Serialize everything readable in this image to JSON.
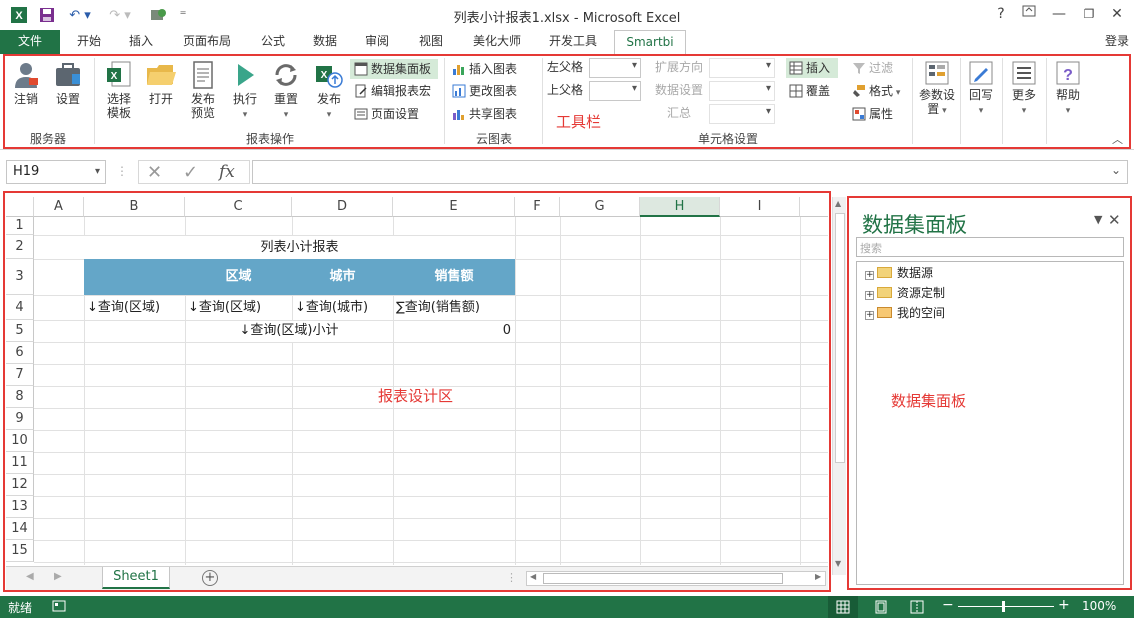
{
  "window": {
    "title": "列表小计报表1.xlsx - Microsoft Excel",
    "help": "?",
    "minimize": "—",
    "restore": "❐",
    "close": "✕",
    "signin": "登录"
  },
  "tabs": [
    "文件",
    "开始",
    "插入",
    "页面布局",
    "公式",
    "数据",
    "审阅",
    "视图",
    "美化大师",
    "开发工具",
    "Smartbi"
  ],
  "ribbon": {
    "server": {
      "logout": "注销",
      "settings": "设置",
      "group": "服务器"
    },
    "report": {
      "select_template": "选择\n模板",
      "open": "打开",
      "publish_preview": "发布\n预览",
      "execute": "执行",
      "reset": "重置",
      "publish": "发布",
      "dataset_panel": "数据集面板",
      "edit_macro": "编辑报表宏",
      "page_setup": "页面设置",
      "group": "报表操作"
    },
    "cloud": {
      "insert_chart": "插入图表",
      "change_chart": "更改图表",
      "share_chart": "共享图表",
      "group": "云图表"
    },
    "toolbar_note": "工具栏",
    "cell": {
      "left_parent": "左父格",
      "top_parent": "上父格",
      "expand_dir": "扩展方向",
      "data_settings": "数据设置",
      "summary": "汇总",
      "insert": "插入",
      "overwrite": "覆盖",
      "filter": "过滤",
      "format": "格式",
      "properties": "属性",
      "group": "单元格设置"
    },
    "param_settings": "参数设\n置",
    "writeback": "回写",
    "more": "更多",
    "help": "帮助"
  },
  "formula": {
    "namebox": "H19",
    "cancel": "✕",
    "enter": "✓",
    "fx": "fx",
    "value": ""
  },
  "sheet": {
    "columns": [
      "A",
      "B",
      "C",
      "D",
      "E",
      "F",
      "G",
      "H",
      "I"
    ],
    "rows": [
      "1",
      "2",
      "3",
      "4",
      "5",
      "6",
      "7",
      "8",
      "9",
      "10",
      "11",
      "12",
      "13",
      "14",
      "15"
    ],
    "title": "列表小计报表",
    "headers": [
      "区域",
      "城市",
      "销售额"
    ],
    "row4": [
      "↓查询(区域)",
      "↓查询(区域)",
      "↓查询(城市)",
      "∑查询(销售额)"
    ],
    "row5_label": "↓查询(区域)小计",
    "row5_value": "0",
    "design_note": "报表设计区",
    "sheet_tab": "Sheet1",
    "add_sheet": "+"
  },
  "panel": {
    "title": "数据集面板",
    "search_placeholder": "搜索",
    "tree": [
      "数据源",
      "资源定制",
      "我的空间"
    ],
    "note": "数据集面板"
  },
  "status": {
    "ready": "就绪",
    "zoom": "100%",
    "zoom_minus": "−",
    "zoom_plus": "+"
  },
  "colors": {
    "excel_green": "#217346",
    "header_fill": "#64a6c8",
    "annotation_red": "#e53935"
  }
}
